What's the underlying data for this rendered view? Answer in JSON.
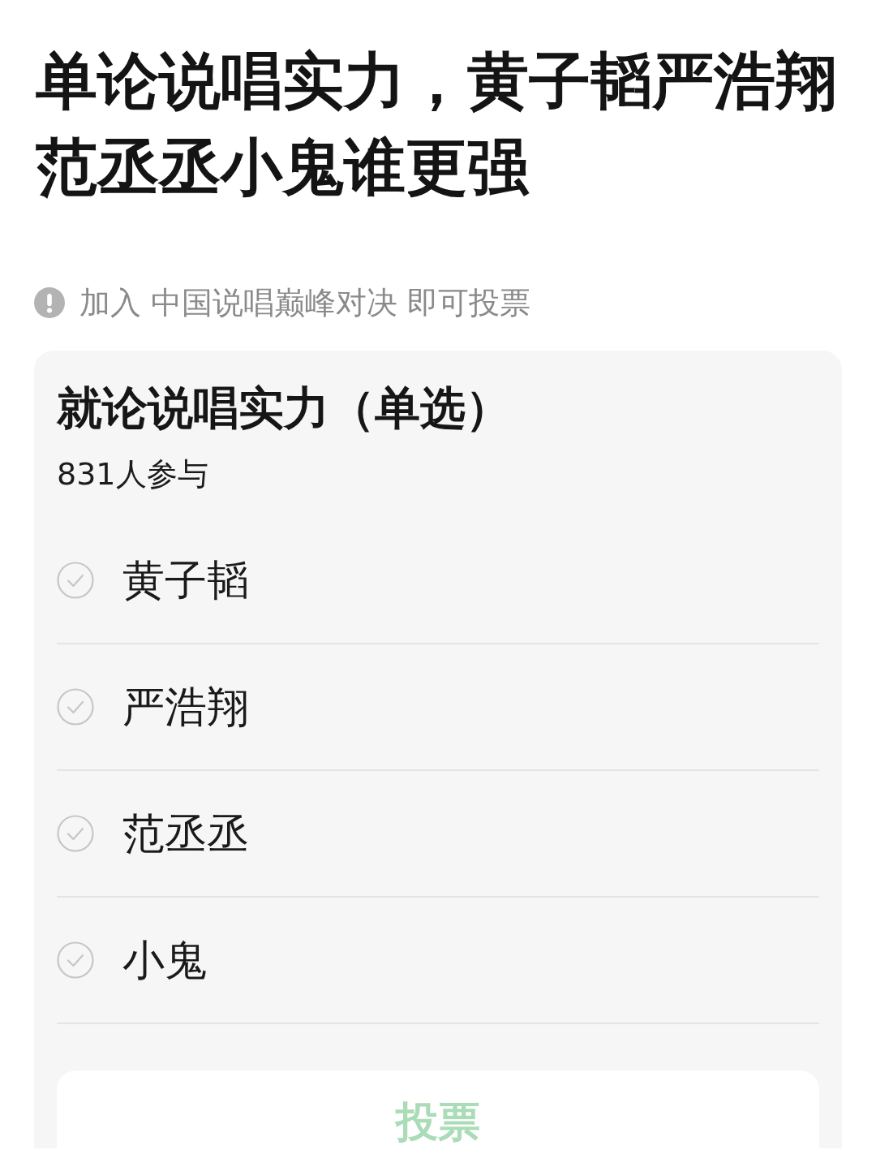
{
  "post": {
    "title": "单论说唱实力，黄子韬严浩翔范丞丞小鬼谁更强"
  },
  "notice": {
    "text": "加入 中国说唱巅峰对决 即可投票"
  },
  "poll": {
    "question": "就论说唱实力（单选）",
    "participants": "831人参与",
    "options": [
      {
        "label": "黄子韬",
        "selected": false
      },
      {
        "label": "严浩翔",
        "selected": false
      },
      {
        "label": "范丞丞",
        "selected": false
      },
      {
        "label": "小鬼",
        "selected": false
      }
    ],
    "vote_button": {
      "label": "投票",
      "disabled": true
    }
  }
}
